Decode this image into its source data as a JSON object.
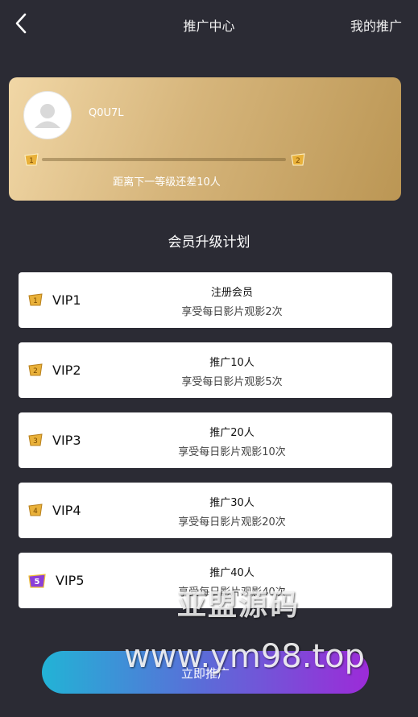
{
  "header": {
    "title": "推广中心",
    "right_link": "我的推广",
    "back_icon": "chevron-left-icon"
  },
  "profile": {
    "username": "Q0U7L",
    "current_level": "1",
    "next_level": "2",
    "progress_fraction": 0,
    "progress_text": "距离下一等级还差10人"
  },
  "plan": {
    "title": "会员升级计划",
    "tiers": [
      {
        "name": "VIP1",
        "level": "1",
        "requirement": "注册会员",
        "benefit": "享受每日影片观影2次"
      },
      {
        "name": "VIP2",
        "level": "2",
        "requirement": "推广10人",
        "benefit": "享受每日影片观影5次"
      },
      {
        "name": "VIP3",
        "level": "3",
        "requirement": "推广20人",
        "benefit": "享受每日影片观影10次"
      },
      {
        "name": "VIP4",
        "level": "4",
        "requirement": "推广30人",
        "benefit": "享受每日影片观影20次"
      },
      {
        "name": "VIP5",
        "level": "5",
        "requirement": "推广40人",
        "benefit": "享受每日影片观影40次"
      }
    ]
  },
  "cta": {
    "label": "立即推广"
  },
  "watermark": {
    "cn": "亚盟源码",
    "url": "www.ym98.top"
  },
  "colors": {
    "background": "#2b2b34",
    "card_gold_start": "#f1d7a6",
    "card_gold_end": "#bb9654",
    "badge_gold": "#e9b13a",
    "badge_purple": "#8b3fd9",
    "cta_start": "#22b3d6",
    "cta_end": "#9c2bd8"
  }
}
